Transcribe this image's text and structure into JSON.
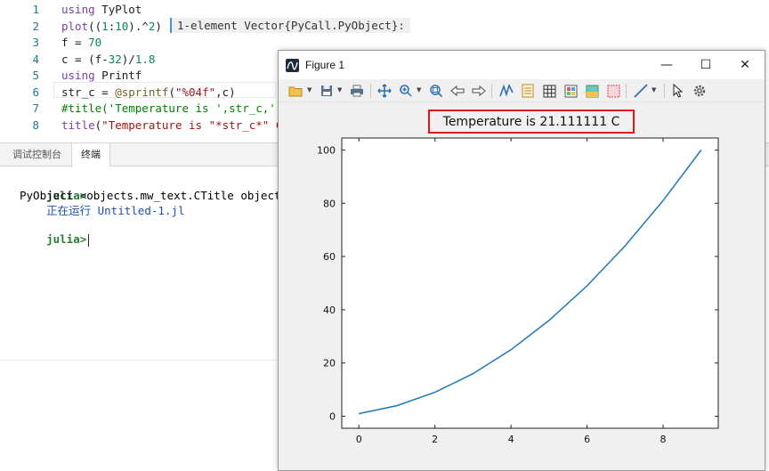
{
  "editor": {
    "line_numbers": [
      "1",
      "2",
      "3",
      "4",
      "5",
      "6",
      "7",
      "8"
    ],
    "lines": [
      [
        {
          "t": "using",
          "c": "kw"
        },
        {
          "t": " TyPlot",
          "c": ""
        }
      ],
      [
        {
          "t": "plot",
          "c": "fn"
        },
        {
          "t": "((",
          "c": ""
        },
        {
          "t": "1",
          "c": "num"
        },
        {
          "t": ":",
          "c": ""
        },
        {
          "t": "10",
          "c": "num"
        },
        {
          "t": ").^",
          "c": ""
        },
        {
          "t": "2",
          "c": "num"
        },
        {
          "t": ")",
          "c": ""
        }
      ],
      [
        {
          "t": "f = ",
          "c": ""
        },
        {
          "t": "70",
          "c": "num"
        }
      ],
      [
        {
          "t": "c = (f-",
          "c": ""
        },
        {
          "t": "32",
          "c": "num"
        },
        {
          "t": ")/",
          "c": ""
        },
        {
          "t": "1.8",
          "c": "num"
        }
      ],
      [
        {
          "t": "using",
          "c": "kw"
        },
        {
          "t": " Printf",
          "c": ""
        }
      ],
      [
        {
          "t": "str_c = ",
          "c": ""
        },
        {
          "t": "@sprintf",
          "c": "mac"
        },
        {
          "t": "(",
          "c": ""
        },
        {
          "t": "\"%04f\"",
          "c": "str"
        },
        {
          "t": ",c)",
          "c": ""
        }
      ],
      [
        {
          "t": "#title('Temperature is ',str_c,'",
          "c": "cmt"
        }
      ],
      [
        {
          "t": "title",
          "c": "fn"
        },
        {
          "t": "(",
          "c": ""
        },
        {
          "t": "\"Temperature is \"",
          "c": "str"
        },
        {
          "t": "*str_c*\" C",
          "c": "str"
        }
      ]
    ],
    "inline_result": "1-element Vector{PyCall.PyObject}:"
  },
  "panel": {
    "tabs": [
      "调试控制台",
      "终端"
    ],
    "active_tab": 1,
    "terminal": {
      "prompt": "julia>",
      "run_text": "正在运行 Untitled-1.jl",
      "output": "PyObject <objects.mw_text.CTitle object at",
      "prompt2": "julia>"
    }
  },
  "figure_window": {
    "title": "Figure 1",
    "minimize": "—",
    "maximize": "☐",
    "close": "✕",
    "toolbar_icons": [
      "open-folder-icon",
      "save-icon",
      "print-icon",
      "pan-icon",
      "zoom-in-icon",
      "zoom-fit-icon",
      "back-icon",
      "forward-icon",
      "line-style-icon",
      "legend-icon",
      "grid-icon",
      "colorbar-icon",
      "fill-icon",
      "box-icon",
      "line-icon",
      "pointer-icon",
      "settings-icon"
    ],
    "highlight_color": "#e01818"
  },
  "chart_data": {
    "type": "line",
    "title": "Temperature is 21.111111 C",
    "x": [
      0,
      1,
      2,
      3,
      4,
      5,
      6,
      7,
      8,
      9
    ],
    "series": [
      {
        "values": [
          1,
          4,
          9,
          16,
          25,
          36,
          49,
          64,
          81,
          100
        ],
        "color": "#1f77b4"
      }
    ],
    "xlim": [
      -0.45,
      9.45
    ],
    "ylim": [
      -4.5,
      104.5
    ],
    "xticks": [
      0,
      2,
      4,
      6,
      8
    ],
    "yticks": [
      0,
      20,
      40,
      60,
      80,
      100
    ],
    "grid": false
  }
}
